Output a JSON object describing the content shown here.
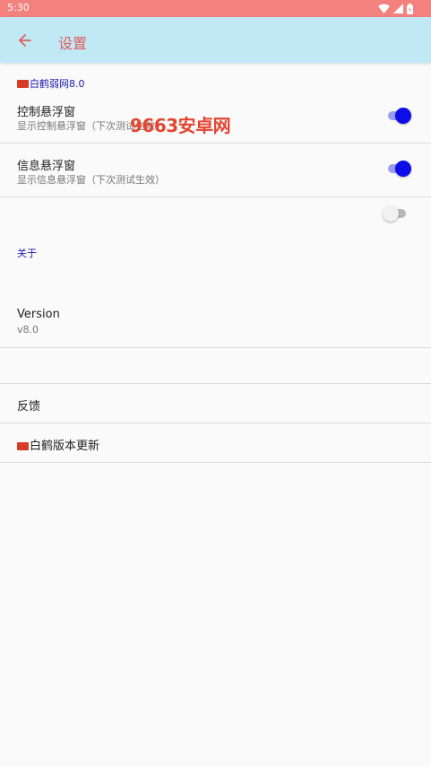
{
  "status_bar": {
    "time": "5:30",
    "icons": [
      "wifi-icon",
      "signal-icon",
      "battery-icon"
    ]
  },
  "app_bar": {
    "title": "设置",
    "back_icon": "arrow-left-icon",
    "background": "#c1e8f5",
    "title_color": "#e25e5e"
  },
  "sections": {
    "main_header": "白鹤弱网8.0",
    "about_header": "关于"
  },
  "settings": {
    "control_float": {
      "title": "控制悬浮窗",
      "subtitle": "显示控制悬浮窗（下次测试生效）",
      "enabled": true
    },
    "info_float": {
      "title": "信息悬浮窗",
      "subtitle": "显示信息悬浮窗（下次测试生效）",
      "enabled": true
    },
    "unlabeled_toggle": {
      "enabled": false
    }
  },
  "about": {
    "version_title": "Version",
    "version_value": "v8.0",
    "feedback": "反馈",
    "update": "白鹤版本更新"
  },
  "watermark": "9663安卓网",
  "colors": {
    "status_bar": "#f3827e",
    "accent": "#0d0de8",
    "section_header": "#1a1ab0"
  }
}
